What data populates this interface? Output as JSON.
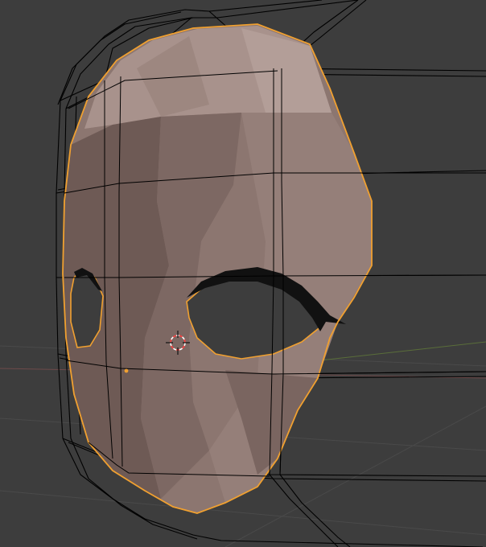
{
  "viewport": {
    "background": "#3d3d3d",
    "grid_color": "#4a4a4a",
    "x_axis_color": "#6e4a4a",
    "y_axis_color": "#5a6e3a",
    "wire_color": "#000000",
    "selection_outline_color": "#f0a030"
  },
  "selected_object": {
    "shape": "face-mask",
    "material_color": "#8c7670",
    "shading": "solid",
    "outline_color": "#f0a030",
    "has_eye_holes": true
  },
  "cursor": {
    "icon": "3d-cursor-icon",
    "ring_color_a": "#ff4040",
    "ring_color_b": "#ffffff"
  },
  "origin": {
    "icon": "object-origin-dot",
    "color": "#f0a030"
  }
}
